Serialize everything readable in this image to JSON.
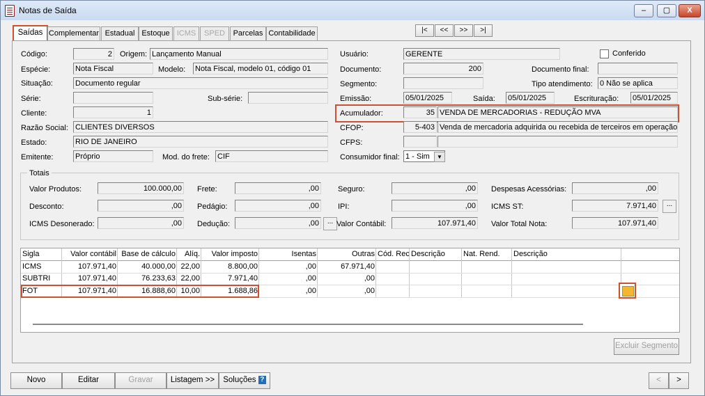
{
  "window": {
    "title": "Notas de Saída",
    "min": "▭",
    "max": "▣",
    "close": "X"
  },
  "tabs": [
    {
      "label": "Saídas",
      "state": "active"
    },
    {
      "label": "Complementar",
      "state": "normal"
    },
    {
      "label": "Estadual",
      "state": "normal"
    },
    {
      "label": "Estoque",
      "state": "normal"
    },
    {
      "label": "ICMS",
      "state": "disabled"
    },
    {
      "label": "SPED",
      "state": "disabled"
    },
    {
      "label": "Parcelas",
      "state": "normal"
    },
    {
      "label": "Contabilidade",
      "state": "normal"
    }
  ],
  "nav": [
    "|<",
    "<<",
    ">>",
    ">|"
  ],
  "form": {
    "codigo_label": "Código:",
    "codigo": "2",
    "origem_label": "Origem:",
    "origem": "Lançamento Manual",
    "especie_label": "Espécie:",
    "especie": "Nota Fiscal",
    "modelo_label": "Modelo:",
    "modelo": "Nota Fiscal, modelo 01, código 01",
    "situacao_label": "Situação:",
    "situacao": "Documento regular",
    "serie_label": "Série:",
    "serie": "",
    "subserie_label": "Sub-série:",
    "subserie": "",
    "cliente_label": "Cliente:",
    "cliente": "1",
    "razao_label": "Razão Social:",
    "razao": "CLIENTES DIVERSOS",
    "estado_label": "Estado:",
    "estado": "RIO DE JANEIRO",
    "emitente_label": "Emitente:",
    "emitente": "Próprio",
    "frete_label": "Mod. do frete:",
    "frete": "CIF",
    "usuario_label": "Usuário:",
    "usuario": "GERENTE",
    "conferido_label": "Conferido",
    "documento_label": "Documento:",
    "documento": "200",
    "docfinal_label": "Documento final:",
    "docfinal": "",
    "segmento_label": "Segmento:",
    "segmento": "",
    "tipoatend_label": "Tipo atendimento:",
    "tipoatend": "0 Não se aplica",
    "emissao_label": "Emissão:",
    "emissao": "05/01/2025",
    "saida_label": "Saída:",
    "saida": "05/01/2025",
    "escrituracao_label": "Escrituração:",
    "escrituracao": "05/01/2025",
    "acumulador_label": "Acumulador:",
    "acumulador_code": "35",
    "acumulador_desc": "VENDA DE MERCADORIAS - REDUÇÃO MVA",
    "cfop_label": "CFOP:",
    "cfop_code": "5-403",
    "cfop_desc": "Venda de mercadoria adquirida ou recebida de terceiros em operação co",
    "cfps_label": "CFPS:",
    "cfps_code": "",
    "cfps_desc": "",
    "consumidor_label": "Consumidor final:",
    "consumidor": "1 - Sim"
  },
  "totais": {
    "title": "Totais",
    "valor_produtos_label": "Valor Produtos:",
    "valor_produtos": "100.000,00",
    "frete_label": "Frete:",
    "frete": ",00",
    "seguro_label": "Seguro:",
    "seguro": ",00",
    "despesas_label": "Despesas Acessórias:",
    "despesas": ",00",
    "desconto_label": "Desconto:",
    "desconto": ",00",
    "pedagio_label": "Pedágio:",
    "pedagio": ",00",
    "ipi_label": "IPI:",
    "ipi": ",00",
    "icms_st_label": "ICMS ST:",
    "icms_st": "7.971,40",
    "icms_deson_label": "ICMS Desonerado:",
    "icms_deson": ",00",
    "deducao_label": "Dedução:",
    "deducao": ",00",
    "valor_contabil_label": "Valor Contábil:",
    "valor_contabil": "107.971,40",
    "valor_total_label": "Valor Total Nota:",
    "valor_total": "107.971,40",
    "ellipsis": "..."
  },
  "grid": {
    "headers": [
      "Sigla",
      "Valor contábil",
      "Base de cálculo",
      "Alíq.",
      "Valor imposto",
      "Isentas",
      "Outras",
      "Cód. Rec.",
      "Descrição",
      "Nat. Rend.",
      "Descrição"
    ],
    "rows": [
      [
        "ICMS",
        "107.971,40",
        "40.000,00",
        "22,00",
        "8.800,00",
        ",00",
        "67.971,40",
        "",
        "",
        "",
        ""
      ],
      [
        "SUBTRI",
        "107.971,40",
        "76.233,63",
        "22,00",
        "7.971,40",
        ",00",
        ",00",
        "",
        "",
        "",
        ""
      ],
      [
        "FOT",
        "107.971,40",
        "16.888,60",
        "10,00",
        "1.688,86",
        ",00",
        ",00",
        "",
        "",
        "",
        ""
      ]
    ]
  },
  "buttons": {
    "excluir": "Excluir Segmento",
    "novo": "Novo",
    "editar": "Editar",
    "gravar": "Gravar",
    "listagem": "Listagem >>",
    "solucoes": "Soluções",
    "help": "?",
    "prev": "<",
    "next": ">"
  },
  "colors": {
    "highlight": "#d0502a",
    "calculator": "#f2b632"
  }
}
